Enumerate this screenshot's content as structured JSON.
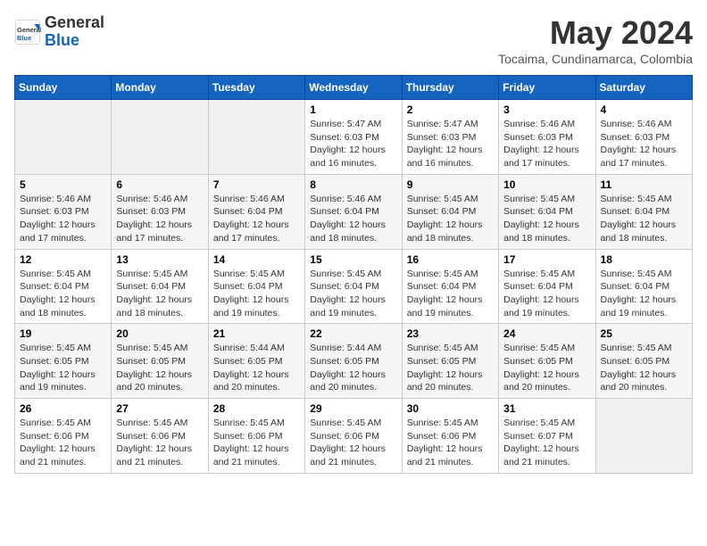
{
  "header": {
    "logo_general": "General",
    "logo_blue": "Blue",
    "month_year": "May 2024",
    "location": "Tocaima, Cundinamarca, Colombia"
  },
  "days_of_week": [
    "Sunday",
    "Monday",
    "Tuesday",
    "Wednesday",
    "Thursday",
    "Friday",
    "Saturday"
  ],
  "weeks": [
    [
      {
        "day": "",
        "info": ""
      },
      {
        "day": "",
        "info": ""
      },
      {
        "day": "",
        "info": ""
      },
      {
        "day": "1",
        "info": "Sunrise: 5:47 AM\nSunset: 6:03 PM\nDaylight: 12 hours and 16 minutes."
      },
      {
        "day": "2",
        "info": "Sunrise: 5:47 AM\nSunset: 6:03 PM\nDaylight: 12 hours and 16 minutes."
      },
      {
        "day": "3",
        "info": "Sunrise: 5:46 AM\nSunset: 6:03 PM\nDaylight: 12 hours and 17 minutes."
      },
      {
        "day": "4",
        "info": "Sunrise: 5:46 AM\nSunset: 6:03 PM\nDaylight: 12 hours and 17 minutes."
      }
    ],
    [
      {
        "day": "5",
        "info": "Sunrise: 5:46 AM\nSunset: 6:03 PM\nDaylight: 12 hours and 17 minutes."
      },
      {
        "day": "6",
        "info": "Sunrise: 5:46 AM\nSunset: 6:03 PM\nDaylight: 12 hours and 17 minutes."
      },
      {
        "day": "7",
        "info": "Sunrise: 5:46 AM\nSunset: 6:04 PM\nDaylight: 12 hours and 17 minutes."
      },
      {
        "day": "8",
        "info": "Sunrise: 5:46 AM\nSunset: 6:04 PM\nDaylight: 12 hours and 18 minutes."
      },
      {
        "day": "9",
        "info": "Sunrise: 5:45 AM\nSunset: 6:04 PM\nDaylight: 12 hours and 18 minutes."
      },
      {
        "day": "10",
        "info": "Sunrise: 5:45 AM\nSunset: 6:04 PM\nDaylight: 12 hours and 18 minutes."
      },
      {
        "day": "11",
        "info": "Sunrise: 5:45 AM\nSunset: 6:04 PM\nDaylight: 12 hours and 18 minutes."
      }
    ],
    [
      {
        "day": "12",
        "info": "Sunrise: 5:45 AM\nSunset: 6:04 PM\nDaylight: 12 hours and 18 minutes."
      },
      {
        "day": "13",
        "info": "Sunrise: 5:45 AM\nSunset: 6:04 PM\nDaylight: 12 hours and 18 minutes."
      },
      {
        "day": "14",
        "info": "Sunrise: 5:45 AM\nSunset: 6:04 PM\nDaylight: 12 hours and 19 minutes."
      },
      {
        "day": "15",
        "info": "Sunrise: 5:45 AM\nSunset: 6:04 PM\nDaylight: 12 hours and 19 minutes."
      },
      {
        "day": "16",
        "info": "Sunrise: 5:45 AM\nSunset: 6:04 PM\nDaylight: 12 hours and 19 minutes."
      },
      {
        "day": "17",
        "info": "Sunrise: 5:45 AM\nSunset: 6:04 PM\nDaylight: 12 hours and 19 minutes."
      },
      {
        "day": "18",
        "info": "Sunrise: 5:45 AM\nSunset: 6:04 PM\nDaylight: 12 hours and 19 minutes."
      }
    ],
    [
      {
        "day": "19",
        "info": "Sunrise: 5:45 AM\nSunset: 6:05 PM\nDaylight: 12 hours and 19 minutes."
      },
      {
        "day": "20",
        "info": "Sunrise: 5:45 AM\nSunset: 6:05 PM\nDaylight: 12 hours and 20 minutes."
      },
      {
        "day": "21",
        "info": "Sunrise: 5:44 AM\nSunset: 6:05 PM\nDaylight: 12 hours and 20 minutes."
      },
      {
        "day": "22",
        "info": "Sunrise: 5:44 AM\nSunset: 6:05 PM\nDaylight: 12 hours and 20 minutes."
      },
      {
        "day": "23",
        "info": "Sunrise: 5:45 AM\nSunset: 6:05 PM\nDaylight: 12 hours and 20 minutes."
      },
      {
        "day": "24",
        "info": "Sunrise: 5:45 AM\nSunset: 6:05 PM\nDaylight: 12 hours and 20 minutes."
      },
      {
        "day": "25",
        "info": "Sunrise: 5:45 AM\nSunset: 6:05 PM\nDaylight: 12 hours and 20 minutes."
      }
    ],
    [
      {
        "day": "26",
        "info": "Sunrise: 5:45 AM\nSunset: 6:06 PM\nDaylight: 12 hours and 21 minutes."
      },
      {
        "day": "27",
        "info": "Sunrise: 5:45 AM\nSunset: 6:06 PM\nDaylight: 12 hours and 21 minutes."
      },
      {
        "day": "28",
        "info": "Sunrise: 5:45 AM\nSunset: 6:06 PM\nDaylight: 12 hours and 21 minutes."
      },
      {
        "day": "29",
        "info": "Sunrise: 5:45 AM\nSunset: 6:06 PM\nDaylight: 12 hours and 21 minutes."
      },
      {
        "day": "30",
        "info": "Sunrise: 5:45 AM\nSunset: 6:06 PM\nDaylight: 12 hours and 21 minutes."
      },
      {
        "day": "31",
        "info": "Sunrise: 5:45 AM\nSunset: 6:07 PM\nDaylight: 12 hours and 21 minutes."
      },
      {
        "day": "",
        "info": ""
      }
    ]
  ]
}
